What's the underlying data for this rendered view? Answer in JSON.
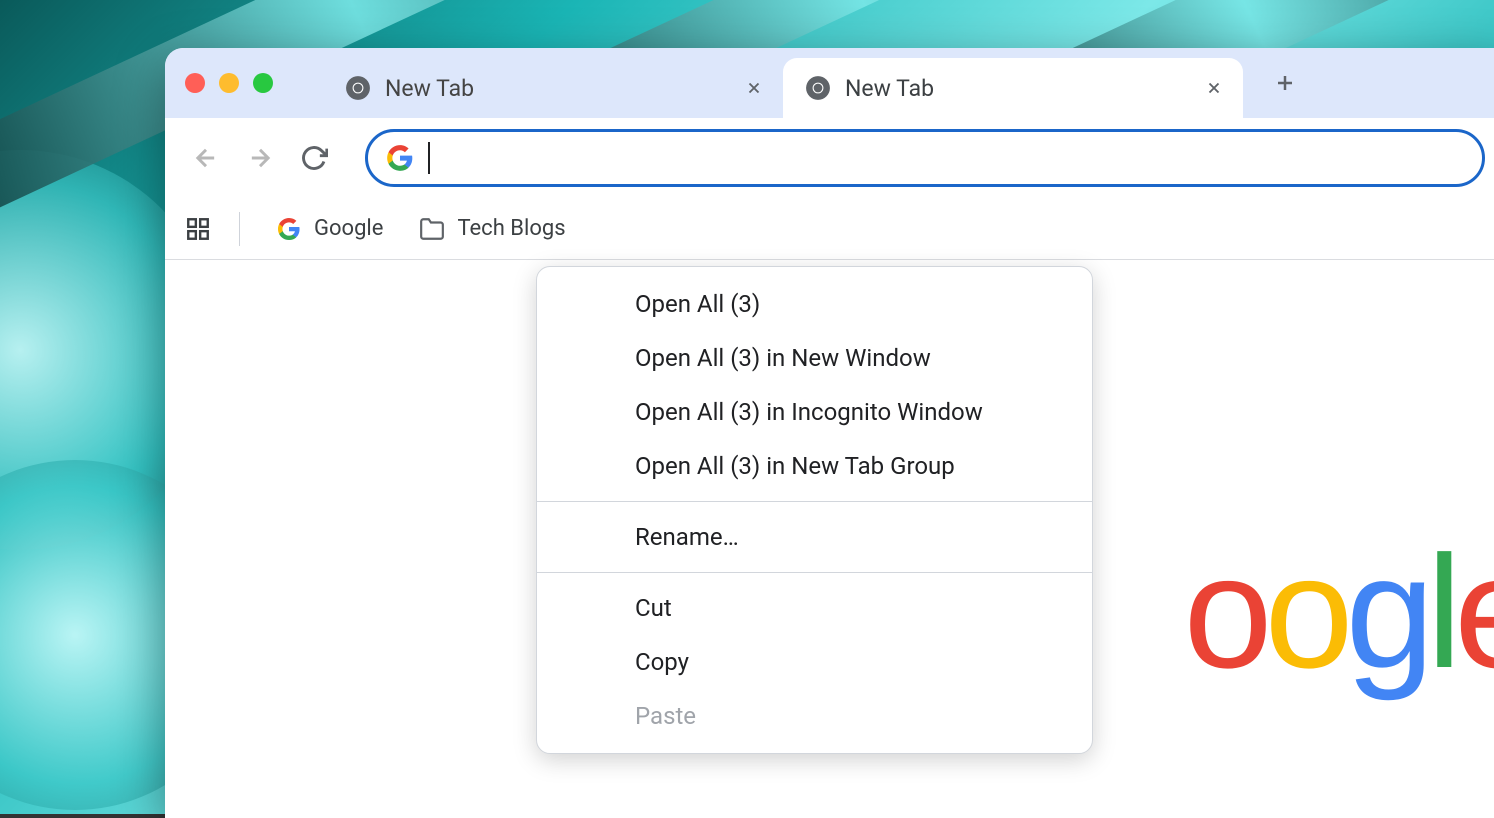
{
  "tabs": [
    {
      "title": "New Tab",
      "active": false
    },
    {
      "title": "New Tab",
      "active": true
    }
  ],
  "omnibox": {
    "value": ""
  },
  "bookmarks": {
    "google": "Google",
    "folder": "Tech Blogs"
  },
  "context_menu": {
    "open_all": "Open All (3)",
    "open_all_window": "Open All (3) in New Window",
    "open_all_incognito": "Open All (3) in Incognito Window",
    "open_all_group": "Open All (3) in New Tab Group",
    "rename": "Rename…",
    "cut": "Cut",
    "copy": "Copy",
    "paste": "Paste"
  },
  "logo_letters": [
    "o",
    "o",
    "g",
    "l",
    "e"
  ]
}
